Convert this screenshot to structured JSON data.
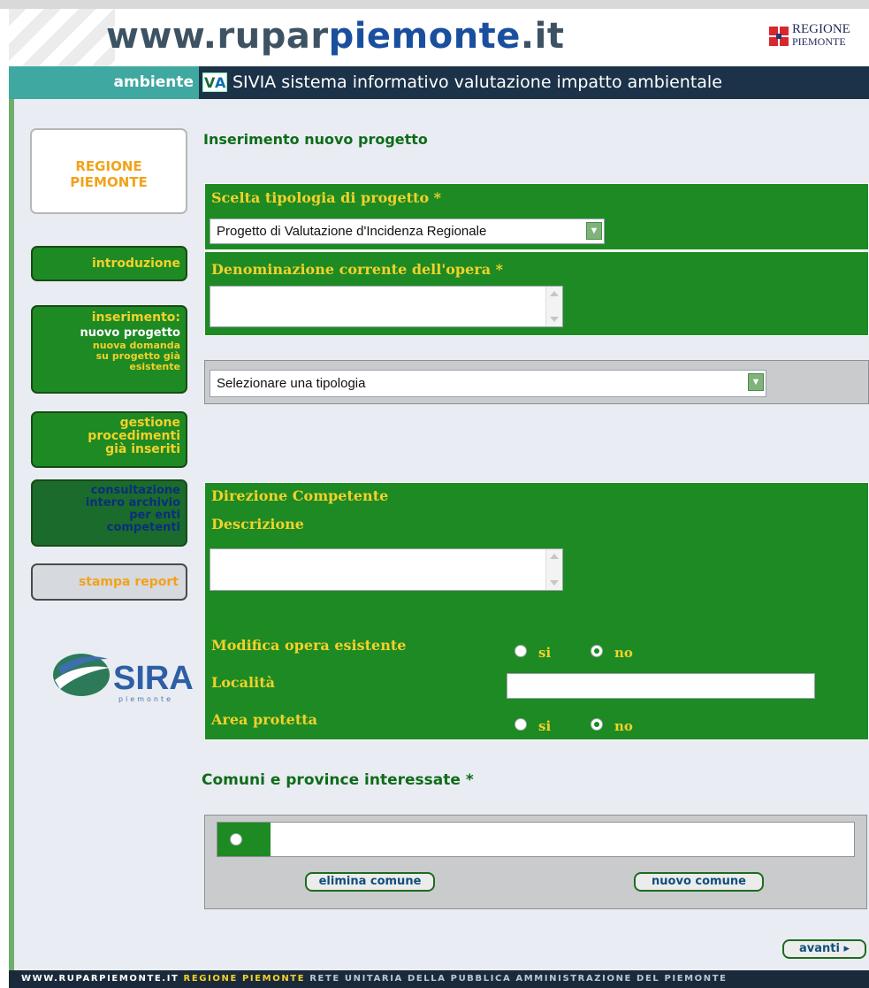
{
  "header": {
    "site_title_part1": "www.rupar",
    "site_title_part2": "piemonte",
    "site_title_part3": ".it",
    "regione_logo_line1": "REGIONE",
    "regione_logo_line2": "PIEMONTE"
  },
  "navbar": {
    "section": "ambiente",
    "logo_text_v": "V",
    "logo_text_a": "A",
    "title": "SIVIA sistema informativo valutazione impatto ambientale"
  },
  "sidebar": {
    "regione_line1": "REGIONE",
    "regione_line2": "PIEMONTE",
    "introduzione": "introduzione",
    "inserimento": "inserimento:",
    "nuovo_progetto": "nuovo progetto",
    "nuova_domanda_1": "nuova domanda",
    "nuova_domanda_2": "su progetto già",
    "nuova_domanda_3": "esistente",
    "gestione_1": "gestione",
    "gestione_2": "procedimenti",
    "gestione_3": "già inseriti",
    "consultazione_1": "consultazione",
    "consultazione_2": "intero archivio",
    "consultazione_3": "per enti",
    "consultazione_4": "competenti",
    "stampa_report": "stampa report",
    "sira_text": "SIRA",
    "sira_sub": "piemonte"
  },
  "main": {
    "page_title": "Inserimento nuovo progetto",
    "tipologia_label": "Scelta tipologia di progetto *",
    "tipologia_value": "Progetto di Valutazione d'Incidenza Regionale",
    "denominazione_label": "Denominazione corrente dell'opera *",
    "denominazione_value": "",
    "selezionare_value": "Selezionare una tipologia",
    "direzione_label": "Direzione Competente",
    "descrizione_label": "Descrizione",
    "descrizione_value": "",
    "modifica_label": "Modifica opera esistente",
    "modifica_options": [
      "si",
      "no"
    ],
    "modifica_selected": "no",
    "localita_label": "Località",
    "localita_value": "",
    "area_label": "Area protetta",
    "area_options": [
      "si",
      "no"
    ],
    "area_selected": "no",
    "comuni_title": "Comuni e province interessate *",
    "comune_value": "",
    "elimina_comune": "elimina comune",
    "nuovo_comune": "nuovo comune",
    "avanti": "avanti ▸"
  },
  "footer": {
    "part1": "WWW.RUPARPIEMONTE.IT",
    "part2": "REGIONE PIEMONTE",
    "part3": "RETE UNITARIA DELLA PUBBLICA AMMINISTRAZIONE DEL PIEMONTE"
  },
  "colors": {
    "green_panel": "#1e8a23",
    "label_yellow": "#f2d12b",
    "title_green": "#0f6b1a",
    "navbar_dark": "#1b3249",
    "ambiente_teal": "#3fa8a0"
  }
}
